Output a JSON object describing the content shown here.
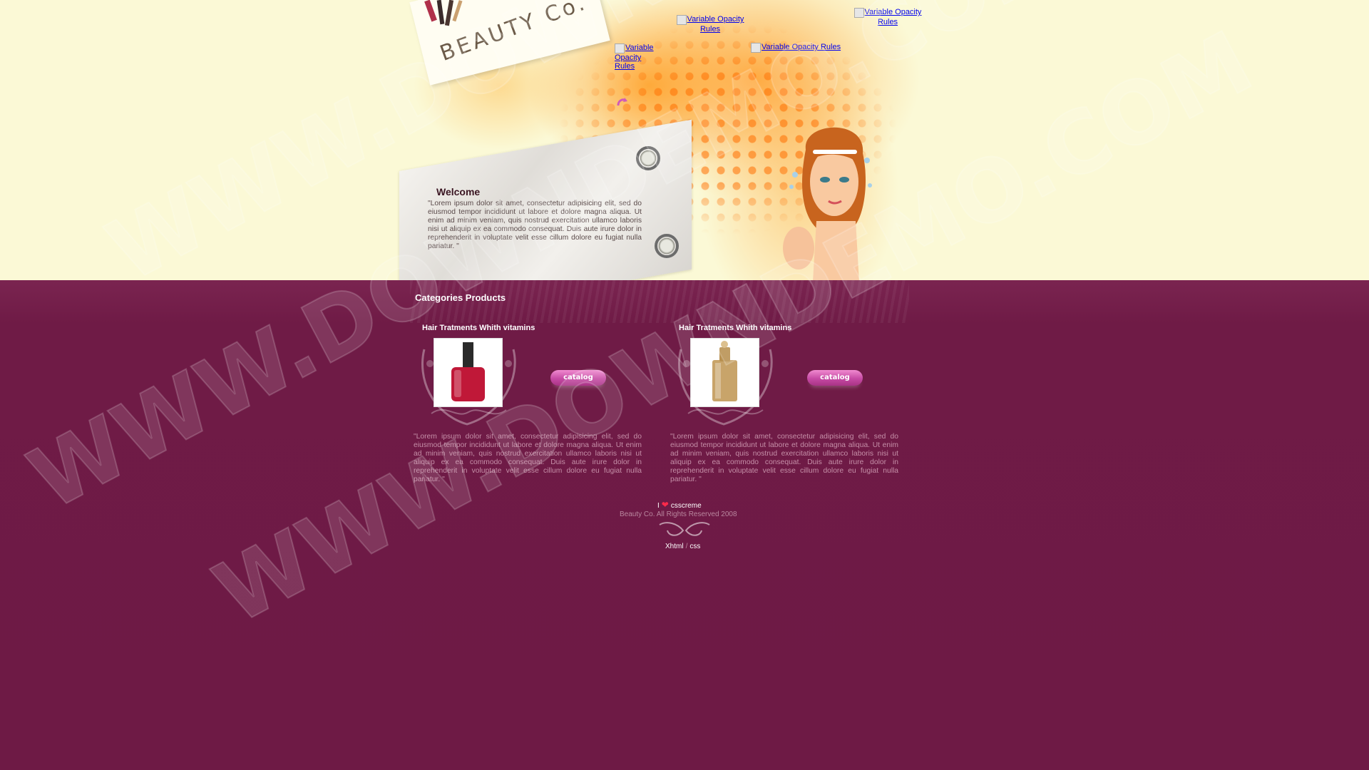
{
  "header": {
    "logo_text": "BEAUTY Co.",
    "nav_images": [
      {
        "alt": "Variable Opacity Rules"
      },
      {
        "alt": "Variable Opacity Rules"
      },
      {
        "alt": "Variable Opacity Rules"
      },
      {
        "alt": "Variable Opacity Rules"
      }
    ]
  },
  "welcome": {
    "title": "Welcome",
    "text": "\"Lorem ipsum dolor sit amet, consectetur adipisicing elit, sed do eiusmod tempor incididunt ut labore et dolore magna aliqua. Ut enim ad minim veniam, quis nostrud exercitation ullamco laboris nisi ut aliquip ex ea commodo consequat. Duis aute irure dolor in reprehenderit in voluptate velit esse cillum dolore eu fugiat nulla pariatur. \""
  },
  "categories": {
    "title": "Categories Products",
    "products": [
      {
        "title": "Hair Tratments Whith vitamins",
        "button": "catalog",
        "text": "\"Lorem ipsum dolor sit amet, consectetur adipisicing elit, sed do eiusmod tempor incididunt ut labore et dolore magna aliqua. Ut enim ad minim veniam, quis nostrud exercitation ullamco laboris nisi ut aliquip ex ea commodo consequat. Duis aute irure dolor in reprehenderit in voluptate velit esse cillum dolore eu fugiat nulla pariatur. \""
      },
      {
        "title": "Hair Tratments Whith vitamins",
        "button": "catalog",
        "text": "\"Lorem ipsum dolor sit amet, consectetur adipisicing elit, sed do eiusmod tempor incididunt ut labore et dolore magna aliqua. Ut enim ad minim veniam, quis nostrud exercitation ullamco laboris nisi ut aliquip ex ea commodo consequat. Duis aute irure dolor in reprehenderit in voluptate velit esse cillum dolore eu fugiat nulla pariatur. \""
      }
    ]
  },
  "footer": {
    "love_prefix": "I",
    "love_link": "csscreme",
    "rights": "Beauty Co. All Rights Reserved 2008",
    "link_xhtml": "Xhtml",
    "separator": "/",
    "link_css": "css"
  },
  "watermark": "WWW.DOWNDEMO.COM",
  "colors": {
    "header_bg": "#fbf9d6",
    "body_bg": "#6e1a45",
    "accent_orange": "#ff8c1a",
    "catalog_pink": "#d45cb0",
    "heart": "#ff2a4a"
  }
}
